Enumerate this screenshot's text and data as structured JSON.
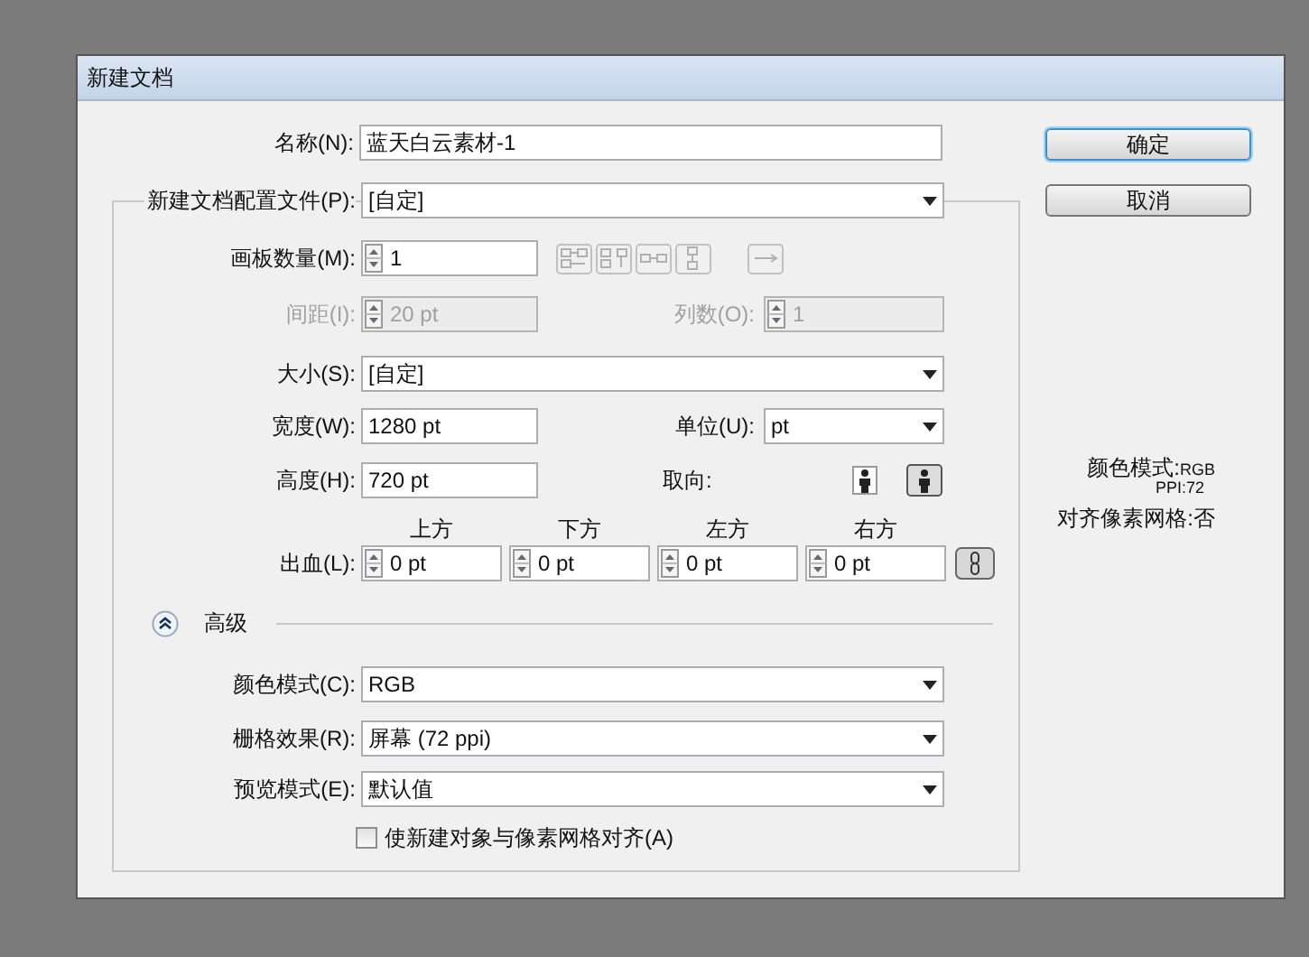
{
  "window": {
    "title": "新建文档"
  },
  "name": {
    "label": "名称(N):",
    "value": "蓝天白云素材-1"
  },
  "profile": {
    "label": "新建文档配置文件(P):",
    "value": "[自定]"
  },
  "artboards": {
    "label": "画板数量(M):",
    "value": "1",
    "arrangement_buttons": [
      {
        "disabled": true
      },
      {
        "disabled": true
      },
      {
        "disabled": true
      },
      {
        "disabled": true
      },
      {
        "disabled": true
      }
    ]
  },
  "spacing": {
    "label": "间距(I):",
    "value": "20 pt",
    "disabled": true
  },
  "columns": {
    "label": "列数(O):",
    "value": "1",
    "disabled": true
  },
  "size": {
    "label": "大小(S):",
    "value": "[自定]"
  },
  "width": {
    "label": "宽度(W):",
    "value": "1280 pt"
  },
  "units": {
    "label": "单位(U):",
    "value": "pt"
  },
  "height": {
    "label": "高度(H):",
    "value": "720 pt"
  },
  "orientation": {
    "label": "取向:",
    "options": [
      {
        "selected": false
      },
      {
        "selected": true
      }
    ]
  },
  "bleed": {
    "label": "出血(L):",
    "sides": [
      {
        "label": "上方",
        "value": "0 pt"
      },
      {
        "label": "下方",
        "value": "0 pt"
      },
      {
        "label": "左方",
        "value": "0 pt"
      },
      {
        "label": "右方",
        "value": "0 pt"
      }
    ]
  },
  "advanced": {
    "label": "高级",
    "expanded": true
  },
  "color_mode": {
    "label": "颜色模式(C):",
    "value": "RGB"
  },
  "raster": {
    "label": "栅格效果(R):",
    "value": "屏幕 (72 ppi)"
  },
  "preview": {
    "label": "预览模式(E):",
    "value": "默认值"
  },
  "align_checkbox": {
    "label": "使新建对象与像素网格对齐(A)",
    "checked": false
  },
  "buttons": [
    {
      "label": "确定",
      "default": true
    },
    {
      "label": "取消",
      "default": false
    }
  ],
  "info": [
    {
      "kind": "pair",
      "label": "颜色模式:",
      "value": "RGB"
    },
    {
      "kind": "minor",
      "text": "PPI:72"
    },
    {
      "kind": "major",
      "text": "对齐像素网格:否"
    }
  ]
}
